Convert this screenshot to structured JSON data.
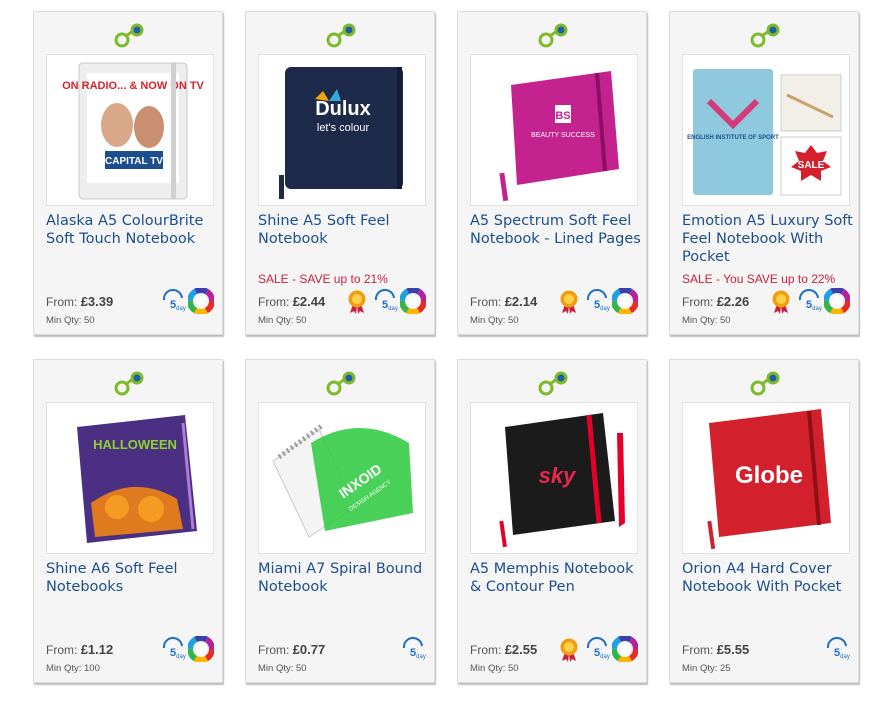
{
  "products": [
    {
      "title": "Alaska A5 ColourBrite Soft Touch Notebook",
      "sale": "",
      "from_label": "From:",
      "price": "£3.39",
      "min_qty": "Min Qty: 50",
      "badges": [
        "5day-icon",
        "colour-wheel-icon"
      ],
      "image": {
        "color": "#eeeeee",
        "caption": "ON RADIO... & NOW ON TV",
        "brand": "CAPITAL TV"
      }
    },
    {
      "title": "Shine A5 Soft Feel Notebook",
      "sale": "SALE - SAVE up to 21%",
      "from_label": "From:",
      "price": "£2.44",
      "min_qty": "Min Qty: 50",
      "badges": [
        "award-icon",
        "5day-icon",
        "colour-wheel-icon"
      ],
      "image": {
        "color": "#1e2a4a",
        "brand": "Dulux",
        "caption": "let's colour"
      }
    },
    {
      "title": "A5 Spectrum Soft Feel Notebook - Lined Pages",
      "sale": "",
      "from_label": "From:",
      "price": "£2.14",
      "min_qty": "Min Qty: 50",
      "badges": [
        "award-icon",
        "5day-icon",
        "colour-wheel-icon"
      ],
      "image": {
        "color": "#c4228e",
        "brand": "BS",
        "caption": "BEAUTY SUCCESS"
      }
    },
    {
      "title": "Emotion A5 Luxury Soft Feel Notebook With Pocket",
      "sale": "SALE - You SAVE up to 22%",
      "from_label": "From:",
      "price": "£2.26",
      "min_qty": "Min Qty: 50",
      "badges": [
        "award-icon",
        "5day-icon",
        "colour-wheel-icon"
      ],
      "image": {
        "color": "#8ec9de",
        "brand": "ENGLISH INSTITUTE OF SPORT",
        "caption": "SALE"
      }
    },
    {
      "title": "Shine A6 Soft Feel Notebooks",
      "sale": "",
      "from_label": "From:",
      "price": "£1.12",
      "min_qty": "Min Qty: 100",
      "badges": [
        "5day-icon",
        "colour-wheel-icon"
      ],
      "image": {
        "color": "#4b2f82",
        "brand": "HALLOWEEN",
        "caption": ""
      }
    },
    {
      "title": "Miami A7 Spiral Bound Notebook",
      "sale": "",
      "from_label": "From:",
      "price": "£0.77",
      "min_qty": "Min Qty: 50",
      "badges": [
        "5day-icon"
      ],
      "image": {
        "color": "#29c93c",
        "brand": "INXOID",
        "caption": "DESIGN AGENCY"
      }
    },
    {
      "title": "A5 Memphis Notebook & Contour Pen",
      "sale": "",
      "from_label": "From:",
      "price": "£2.55",
      "min_qty": "Min Qty: 50",
      "badges": [
        "award-icon",
        "5day-icon",
        "colour-wheel-icon"
      ],
      "image": {
        "color": "#1b1b1b",
        "brand": "sky",
        "caption": ""
      }
    },
    {
      "title": "Orion A4 Hard Cover Notebook With Pocket",
      "sale": "",
      "from_label": "From:",
      "price": "£5.55",
      "min_qty": "Min Qty: 25",
      "badges": [
        "5day-icon"
      ],
      "image": {
        "color": "#d2202c",
        "brand": "Globe",
        "caption": ""
      }
    }
  ],
  "colors": {
    "title": "#1c4e8e",
    "sale": "#cc1f3c",
    "link_icon_green": "#7fba2a",
    "link_icon_blue": "#1e5fa8",
    "five_day_blue": "#1f6fc4"
  }
}
